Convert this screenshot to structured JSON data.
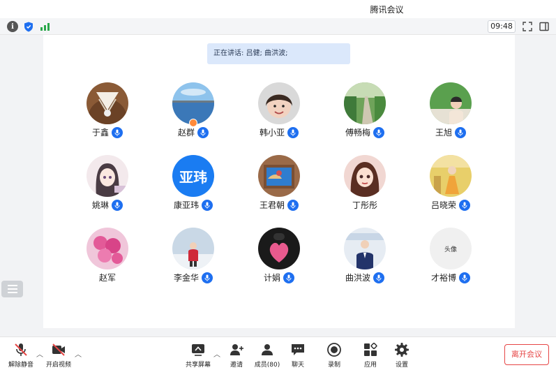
{
  "window": {
    "title": "腾讯会议"
  },
  "topbar": {
    "time": "09:48"
  },
  "speaking": {
    "label": "正在讲话:",
    "names": "吕健; 曲洪波;"
  },
  "participants": [
    {
      "name": "于鑫",
      "avatar": "shuttlecocks",
      "mic": true
    },
    {
      "name": "赵群",
      "avatar": "lake",
      "mic": true,
      "badge": "host-badge"
    },
    {
      "name": "韩小亚",
      "avatar": "child",
      "mic": true
    },
    {
      "name": "傅畅梅",
      "avatar": "path",
      "mic": true
    },
    {
      "name": "王旭",
      "avatar": "woman-garden",
      "mic": true
    },
    {
      "name": "姚琳",
      "avatar": "anime-girl",
      "mic": true
    },
    {
      "name": "康亚玮",
      "avatar_text": "亚玮",
      "mic": true
    },
    {
      "name": "王君朝",
      "avatar": "frame",
      "mic": true
    },
    {
      "name": "丁彤彤",
      "avatar": "cartoon-girl",
      "mic": false
    },
    {
      "name": "吕晓荣",
      "avatar": "dress",
      "mic": true
    },
    {
      "name": "赵军",
      "avatar": "roses",
      "mic": false
    },
    {
      "name": "李金华",
      "avatar": "person-snow",
      "mic": true
    },
    {
      "name": "计娟",
      "avatar": "heart",
      "mic": true
    },
    {
      "name": "曲洪波",
      "avatar": "man-suit",
      "mic": true
    },
    {
      "name": "才裕博",
      "avatar_text": "头像",
      "mic": true
    }
  ],
  "toolbar": {
    "mute": "解除静音",
    "video": "开启视频",
    "share": "共享屏幕",
    "invite": "邀请",
    "members": "成员(80)",
    "chat": "聊天",
    "record": "录制",
    "apps": "应用",
    "settings": "设置",
    "leave": "离开会议"
  },
  "colors": {
    "accent": "#1e6ff0",
    "leave": "#e64545",
    "speaking_bg": "#dbe8fb"
  }
}
